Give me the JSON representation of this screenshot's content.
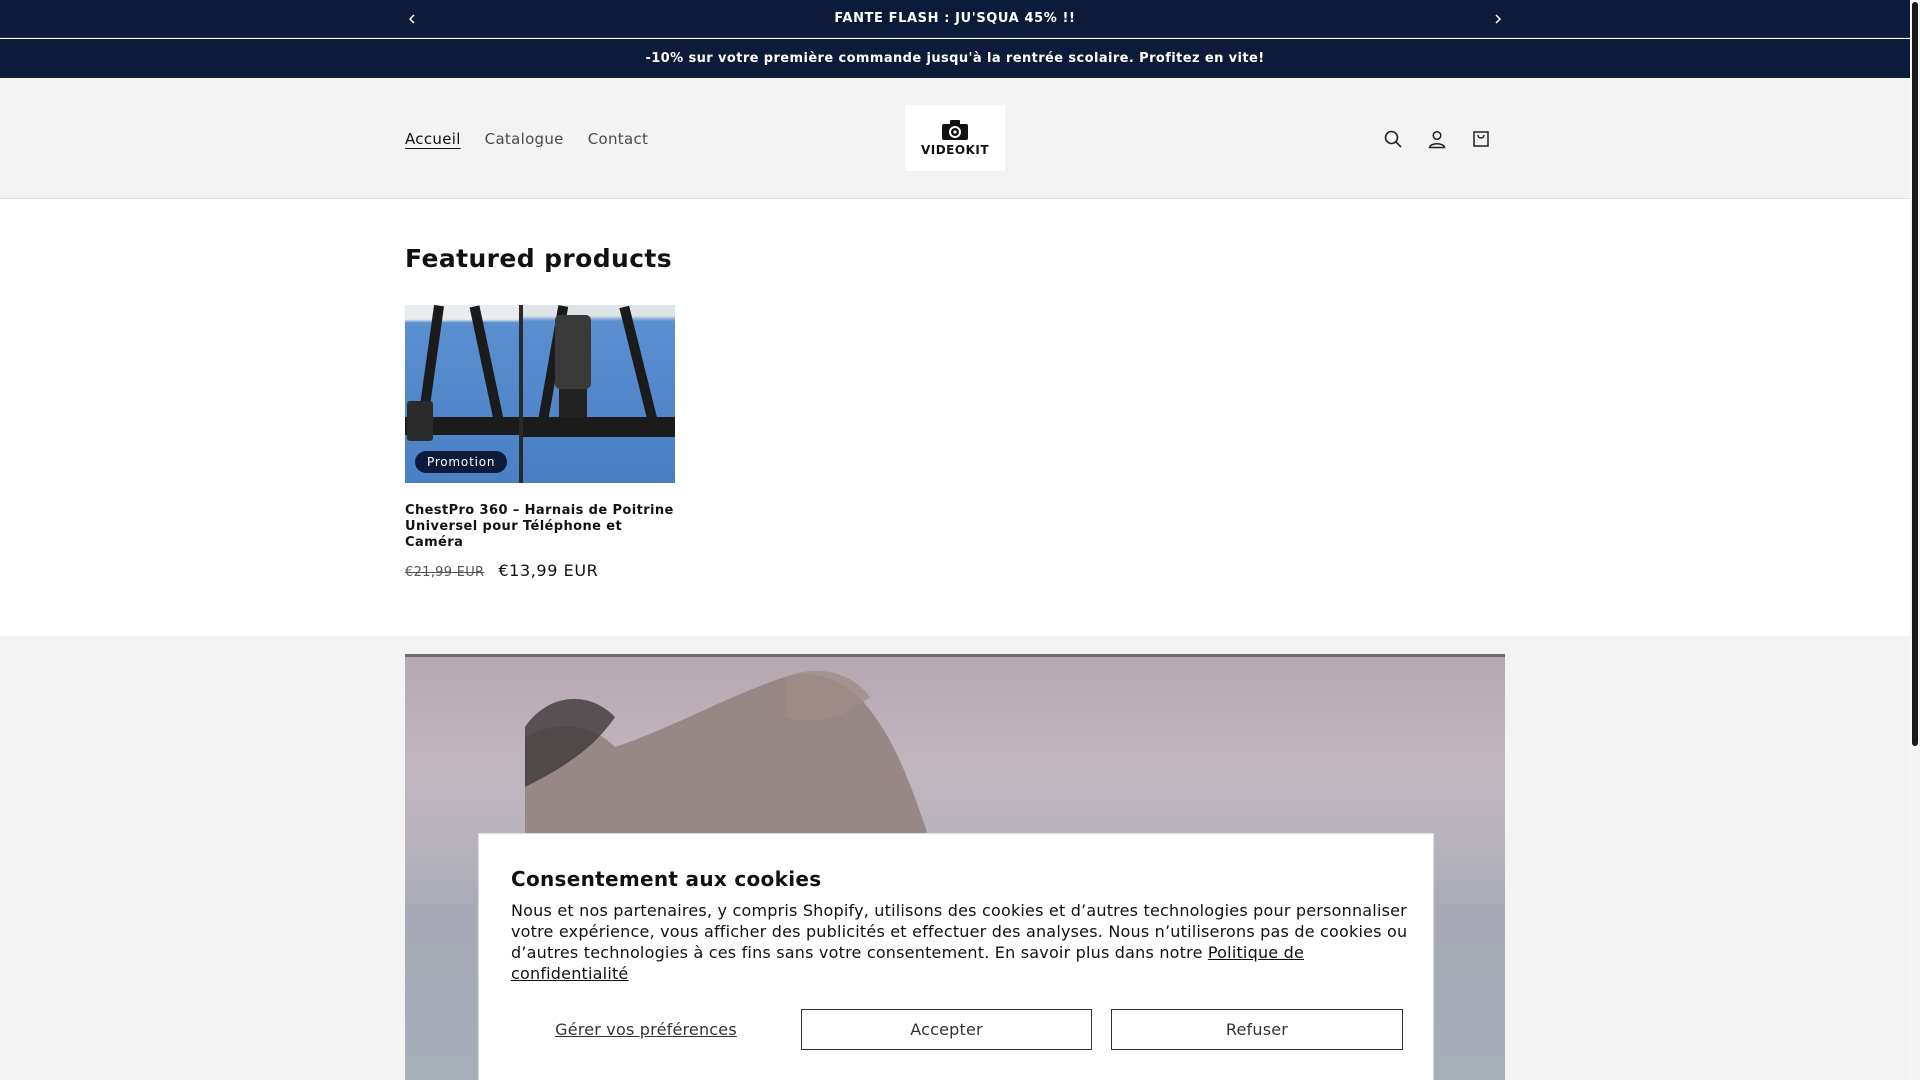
{
  "announcements": {
    "flash": "FANTE FLASH : JU'SQUA 45% !!",
    "promo": "-10% sur votre première commande jusqu'à la rentrée scolaire. Profitez en vite!"
  },
  "header": {
    "nav": [
      "Accueil",
      "Catalogue",
      "Contact"
    ],
    "logo_text": "VIDEOKIT",
    "icons": [
      "search-icon",
      "account-icon",
      "cart-icon"
    ]
  },
  "featured": {
    "title": "Featured products",
    "product": {
      "badge": "Promotion",
      "title": "ChestPro 360 – Harnais de Poitrine Universel pour Téléphone et Caméra",
      "price_old": "€21,99 EUR",
      "price_new": "€13,99 EUR"
    }
  },
  "cookie": {
    "title": "Consentement aux cookies",
    "body": "Nous et nos partenaires, y compris Shopify, utilisons des cookies et d’autres technologies pour personnaliser votre expérience, vous afficher des publicités et effectuer des analyses. Nous n’utiliserons pas de cookies ou d’autres technologies à ces fins sans votre consentement. En savoir plus dans notre ",
    "link": "Politique de confidentialité",
    "manage": "Gérer vos préférences",
    "accept": "Accepter",
    "refuse": "Refuser"
  },
  "colors": {
    "announcement_bg": "#0d1b3a",
    "header_bg": "#f3f3f3",
    "badge_bg": "#0d1b3a"
  }
}
